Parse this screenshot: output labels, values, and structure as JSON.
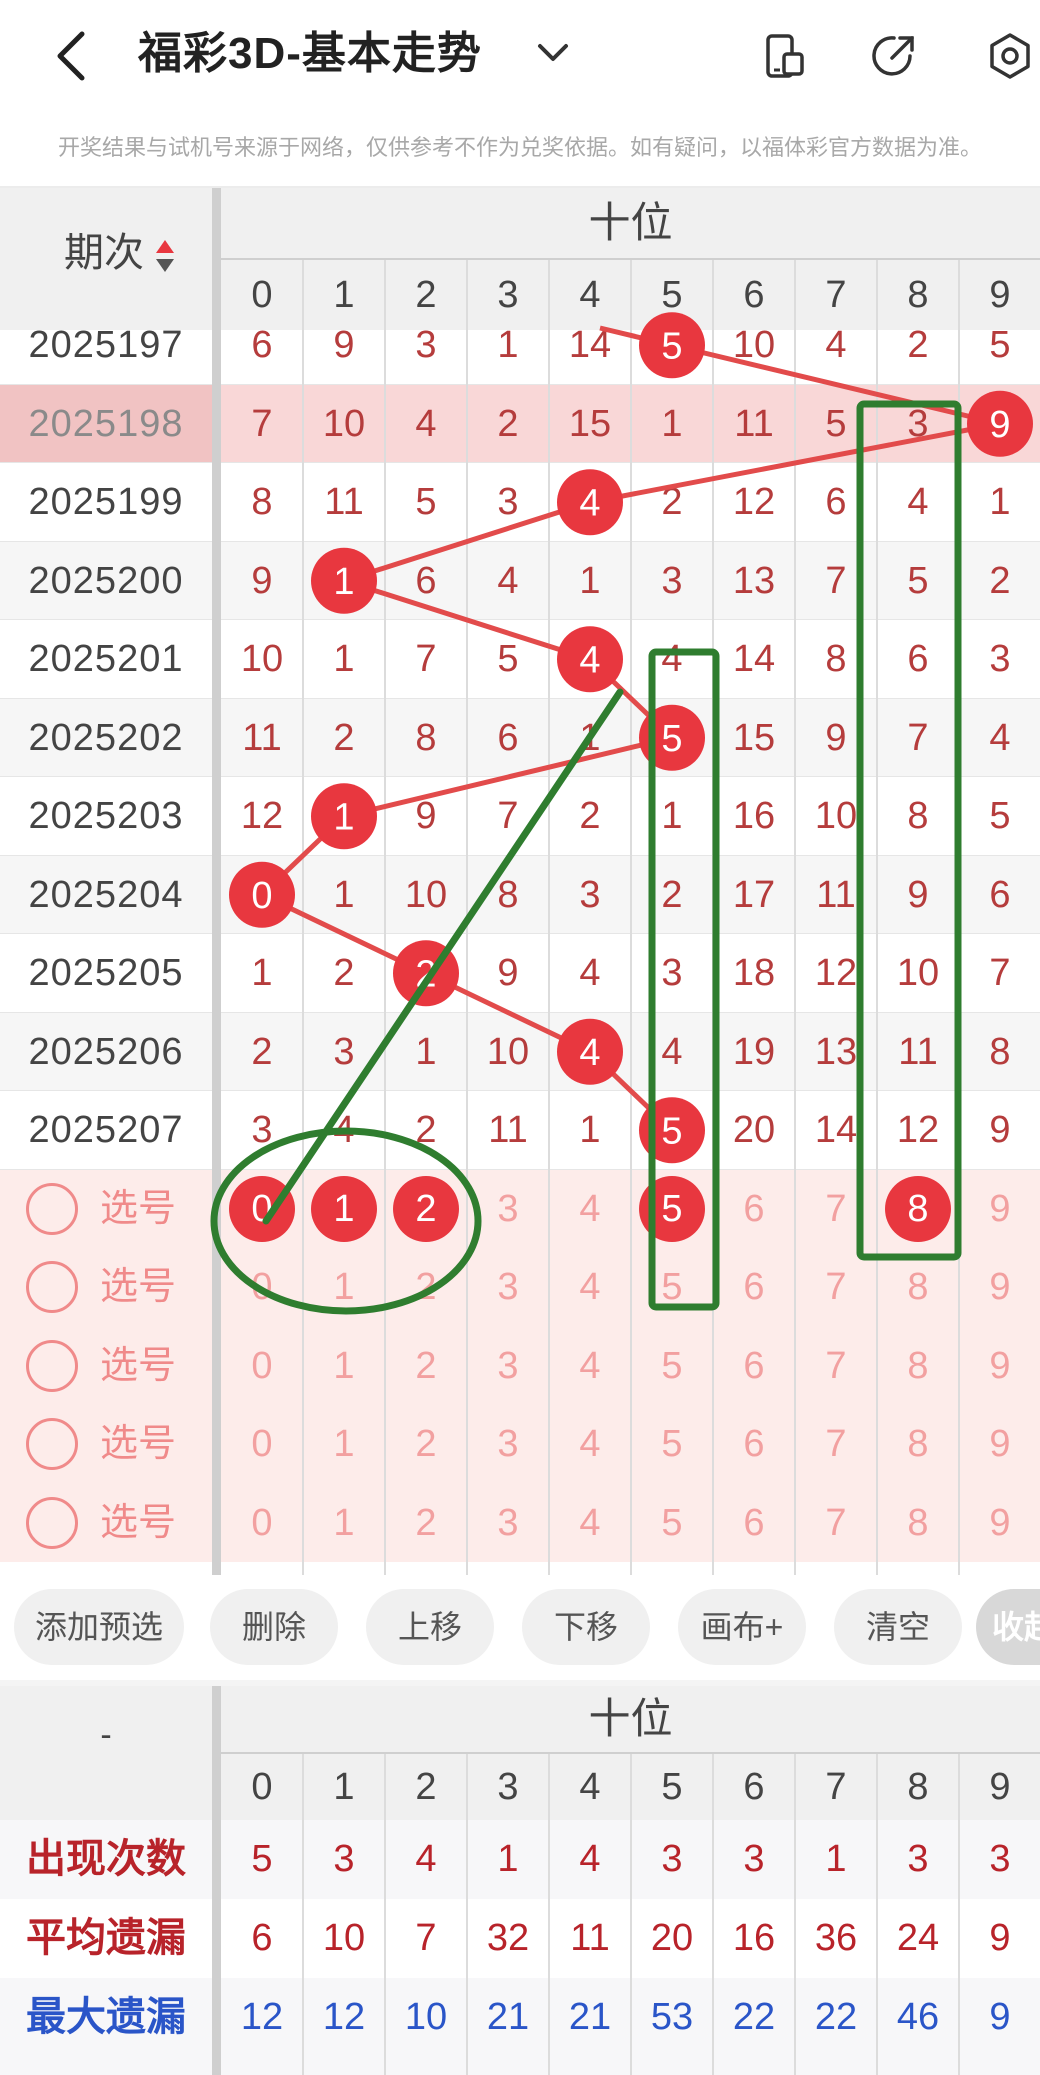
{
  "header": {
    "title": "福彩3D-基本走势",
    "notice": "开奖结果与试机号来源于网络，仅供参考不作为兑奖依据。如有疑问，以福体彩官方数据为准。"
  },
  "table": {
    "period_header": "期次",
    "group_header": "十位",
    "digits": [
      "0",
      "1",
      "2",
      "3",
      "4",
      "5",
      "6",
      "7",
      "8",
      "9"
    ],
    "rows": [
      {
        "period": "2025197",
        "hit": 5,
        "cells": [
          "6",
          "9",
          "3",
          "1",
          "14",
          "5",
          "10",
          "4",
          "2",
          "5"
        ]
      },
      {
        "period": "2025198",
        "hit": 9,
        "highlight": true,
        "cells": [
          "7",
          "10",
          "4",
          "2",
          "15",
          "1",
          "11",
          "5",
          "3",
          "9"
        ]
      },
      {
        "period": "2025199",
        "hit": 4,
        "cells": [
          "8",
          "11",
          "5",
          "3",
          "4",
          "2",
          "12",
          "6",
          "4",
          "1"
        ]
      },
      {
        "period": "2025200",
        "hit": 1,
        "cells": [
          "9",
          "1",
          "6",
          "4",
          "1",
          "3",
          "13",
          "7",
          "5",
          "2"
        ]
      },
      {
        "period": "2025201",
        "hit": 4,
        "cells": [
          "10",
          "1",
          "7",
          "5",
          "4",
          "4",
          "14",
          "8",
          "6",
          "3"
        ]
      },
      {
        "period": "2025202",
        "hit": 5,
        "cells": [
          "11",
          "2",
          "8",
          "6",
          "1",
          "5",
          "15",
          "9",
          "7",
          "4"
        ]
      },
      {
        "period": "2025203",
        "hit": 1,
        "cells": [
          "12",
          "1",
          "9",
          "7",
          "2",
          "1",
          "16",
          "10",
          "8",
          "5"
        ]
      },
      {
        "period": "2025204",
        "hit": 0,
        "cells": [
          "0",
          "1",
          "10",
          "8",
          "3",
          "2",
          "17",
          "11",
          "9",
          "6"
        ]
      },
      {
        "period": "2025205",
        "hit": 2,
        "cells": [
          "1",
          "2",
          "2",
          "9",
          "4",
          "3",
          "18",
          "12",
          "10",
          "7"
        ]
      },
      {
        "period": "2025206",
        "hit": 4,
        "cells": [
          "2",
          "3",
          "1",
          "10",
          "4",
          "4",
          "19",
          "13",
          "11",
          "8"
        ]
      },
      {
        "period": "2025207",
        "hit": 5,
        "cells": [
          "3",
          "4",
          "2",
          "11",
          "1",
          "5",
          "20",
          "14",
          "12",
          "9"
        ]
      }
    ],
    "pick_label": "选号",
    "pick_rows": [
      {
        "selected": [
          0,
          1,
          2,
          5,
          8
        ]
      },
      {
        "selected": []
      },
      {
        "selected": []
      },
      {
        "selected": []
      },
      {
        "selected": []
      }
    ]
  },
  "toolbar": {
    "buttons": [
      "添加预选",
      "删除",
      "上移",
      "下移",
      "画布+",
      "清空"
    ],
    "collapse_label": "收起"
  },
  "stats": {
    "corner": "-",
    "group_header": "十位",
    "rows": [
      {
        "label": "出现次数",
        "color": "#b8232a",
        "values": [
          "5",
          "3",
          "4",
          "1",
          "4",
          "3",
          "3",
          "1",
          "3",
          "3"
        ]
      },
      {
        "label": "平均遗漏",
        "color": "#b8232a",
        "values": [
          "6",
          "10",
          "7",
          "32",
          "11",
          "20",
          "16",
          "36",
          "24",
          "9"
        ]
      },
      {
        "label": "最大遗漏",
        "color": "#2a55c8",
        "values": [
          "12",
          "12",
          "10",
          "21",
          "21",
          "53",
          "22",
          "22",
          "46",
          "9"
        ]
      }
    ]
  },
  "colors": {
    "ball": "#e8373f",
    "trend_line": "#e24b4b",
    "missing_number": "#b53c3c",
    "pick_number": "#f2a0a0",
    "pick_bg": "#fdecea",
    "highlight_row": "#f9d7d7",
    "annotation": "#2f7d2f"
  },
  "icons": [
    "back-icon",
    "chevron-down-icon",
    "phone-icon",
    "share-icon",
    "settings-icon",
    "sort-icon"
  ]
}
